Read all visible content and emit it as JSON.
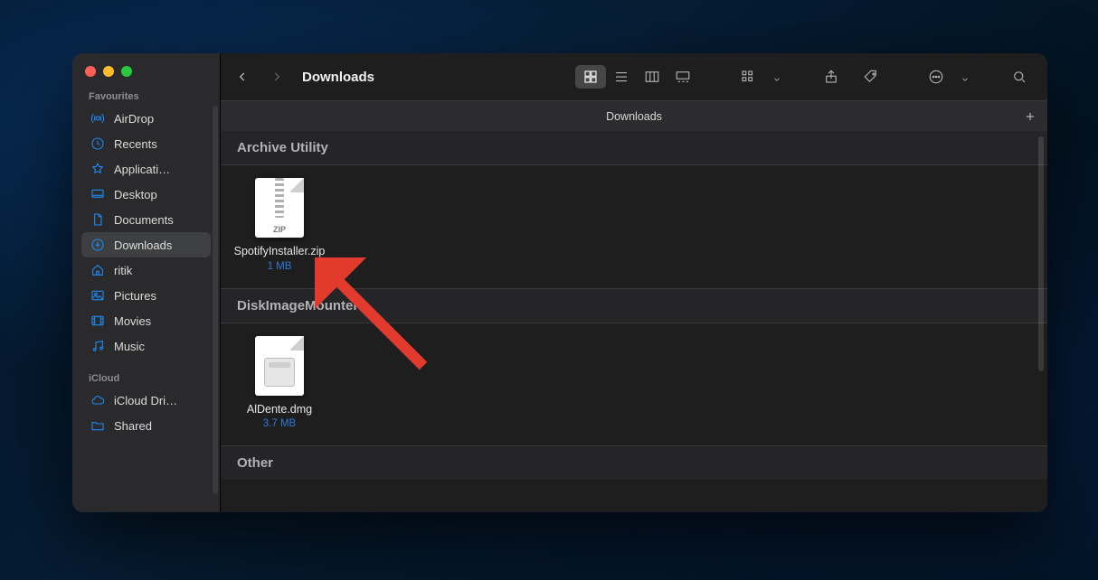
{
  "window_title": "Downloads",
  "pathbar_title": "Downloads",
  "sidebar": {
    "section_favourites": "Favourites",
    "section_icloud": "iCloud",
    "items": [
      {
        "label": "AirDrop"
      },
      {
        "label": "Recents"
      },
      {
        "label": "Applicati…"
      },
      {
        "label": "Desktop"
      },
      {
        "label": "Documents"
      },
      {
        "label": "Downloads"
      },
      {
        "label": "ritik"
      },
      {
        "label": "Pictures"
      },
      {
        "label": "Movies"
      },
      {
        "label": "Music"
      }
    ],
    "icloud_items": [
      {
        "label": "iCloud Dri…"
      },
      {
        "label": "Shared"
      }
    ]
  },
  "groups": [
    {
      "header": "Archive Utility",
      "files": [
        {
          "name": "SpotifyInstaller.zip",
          "size": "1 MB",
          "kind": "zip",
          "zip_label": "ZIP"
        }
      ]
    },
    {
      "header": "DiskImageMounter",
      "files": [
        {
          "name": "AlDente.dmg",
          "size": "3.7 MB",
          "kind": "dmg"
        }
      ]
    },
    {
      "header": "Other",
      "files": []
    }
  ]
}
